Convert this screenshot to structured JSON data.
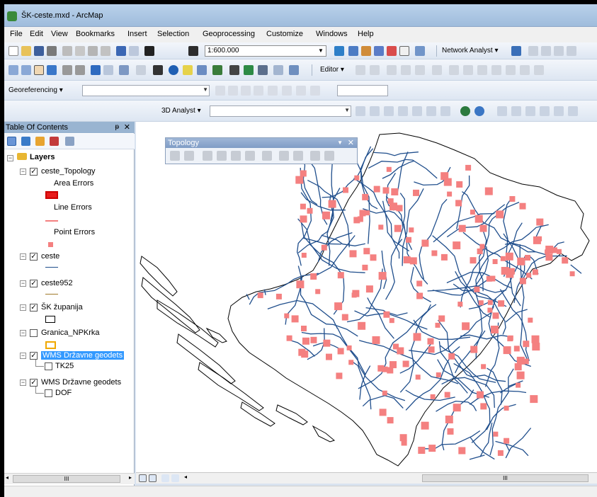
{
  "window": {
    "title": "ŠK-ceste.mxd - ArcMap"
  },
  "menu": [
    "File",
    "Edit",
    "View",
    "Bookmarks",
    "Insert",
    "Selection",
    "Geoprocessing",
    "Customize",
    "Windows",
    "Help"
  ],
  "toolbar": {
    "scale": "1:600.000",
    "network_analyst": "Network Analyst ▾",
    "editor": "Editor ▾",
    "georeferencing": "Georeferencing ▾",
    "analyst_3d": "3D Analyst ▾"
  },
  "toc": {
    "title": "Table Of Contents",
    "pin": "ᵽ",
    "close": "✕",
    "root": "Layers",
    "layers": {
      "ceste_topology": "ceste_Topology",
      "area_errors": "Area Errors",
      "line_errors": "Line Errors",
      "point_errors": "Point Errors",
      "ceste": "ceste",
      "ceste952": "ceste952",
      "sk_zupanija": "ŠK županija",
      "granica": "Granica_NPKrka",
      "wms1": "WMS Državne geodets",
      "tk25": "TK25",
      "wms2": "WMS Državne geodets",
      "dof": "DOF"
    },
    "scroll_thumb": "III"
  },
  "topology": {
    "title": "Topology",
    "close": "✕"
  },
  "map_scroll_thumb": "III",
  "colors": {
    "error_fill": "#f48080",
    "road_stroke": "#1f4e8c",
    "selection": "#3399ff"
  }
}
